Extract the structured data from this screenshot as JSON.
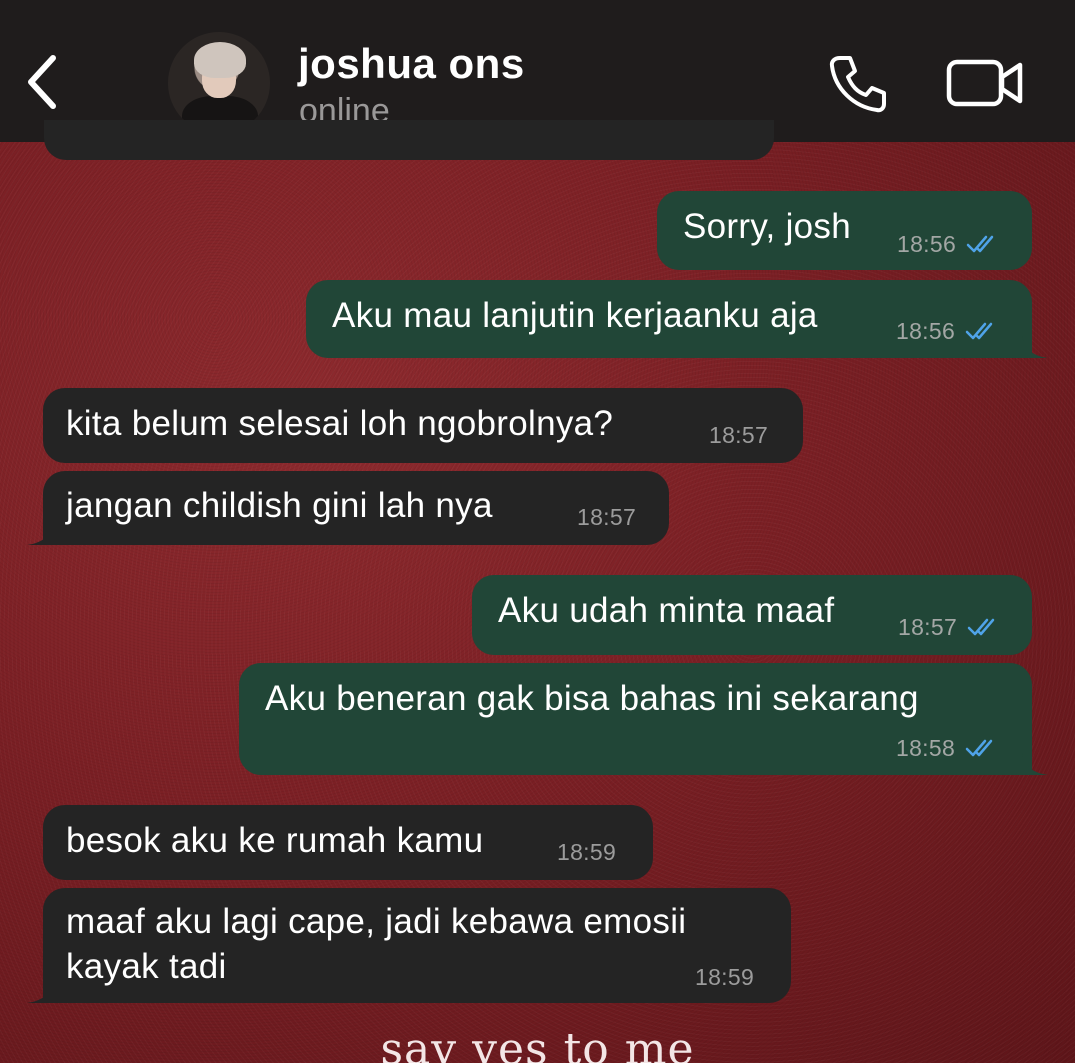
{
  "header": {
    "contact_name": "joshua ons",
    "status": "online"
  },
  "icons": {
    "back": "chevron-left-icon",
    "call": "phone-icon",
    "video": "video-camera-icon",
    "read_receipt": "double-check-icon"
  },
  "colors": {
    "header_bg": "#1f1c1c",
    "outgoing_bubble": "#214637",
    "incoming_bubble": "#242424",
    "read_receipt": "#4fa3e8",
    "wallpaper": "#7a1f24"
  },
  "messages": [
    {
      "direction": "out",
      "text": "Sorry, josh",
      "time": "18:56",
      "read": true
    },
    {
      "direction": "out",
      "text": "Aku mau lanjutin kerjaanku aja",
      "time": "18:56",
      "read": true
    },
    {
      "direction": "in",
      "text": "kita belum selesai loh ngobrolnya?",
      "time": "18:57"
    },
    {
      "direction": "in",
      "text": "jangan childish gini lah nya",
      "time": "18:57"
    },
    {
      "direction": "out",
      "text": "Aku udah minta maaf",
      "time": "18:57",
      "read": true
    },
    {
      "direction": "out",
      "text": "Aku beneran gak bisa bahas ini sekarang",
      "time": "18:58",
      "read": true
    },
    {
      "direction": "in",
      "text": "besok aku ke rumah kamu",
      "time": "18:59"
    },
    {
      "direction": "in",
      "text_line1": "maaf aku lagi cape, jadi kebawa emosii",
      "text_line2": "kayak tadi",
      "time": "18:59"
    }
  ],
  "wallpaper_text": "say yes to me"
}
